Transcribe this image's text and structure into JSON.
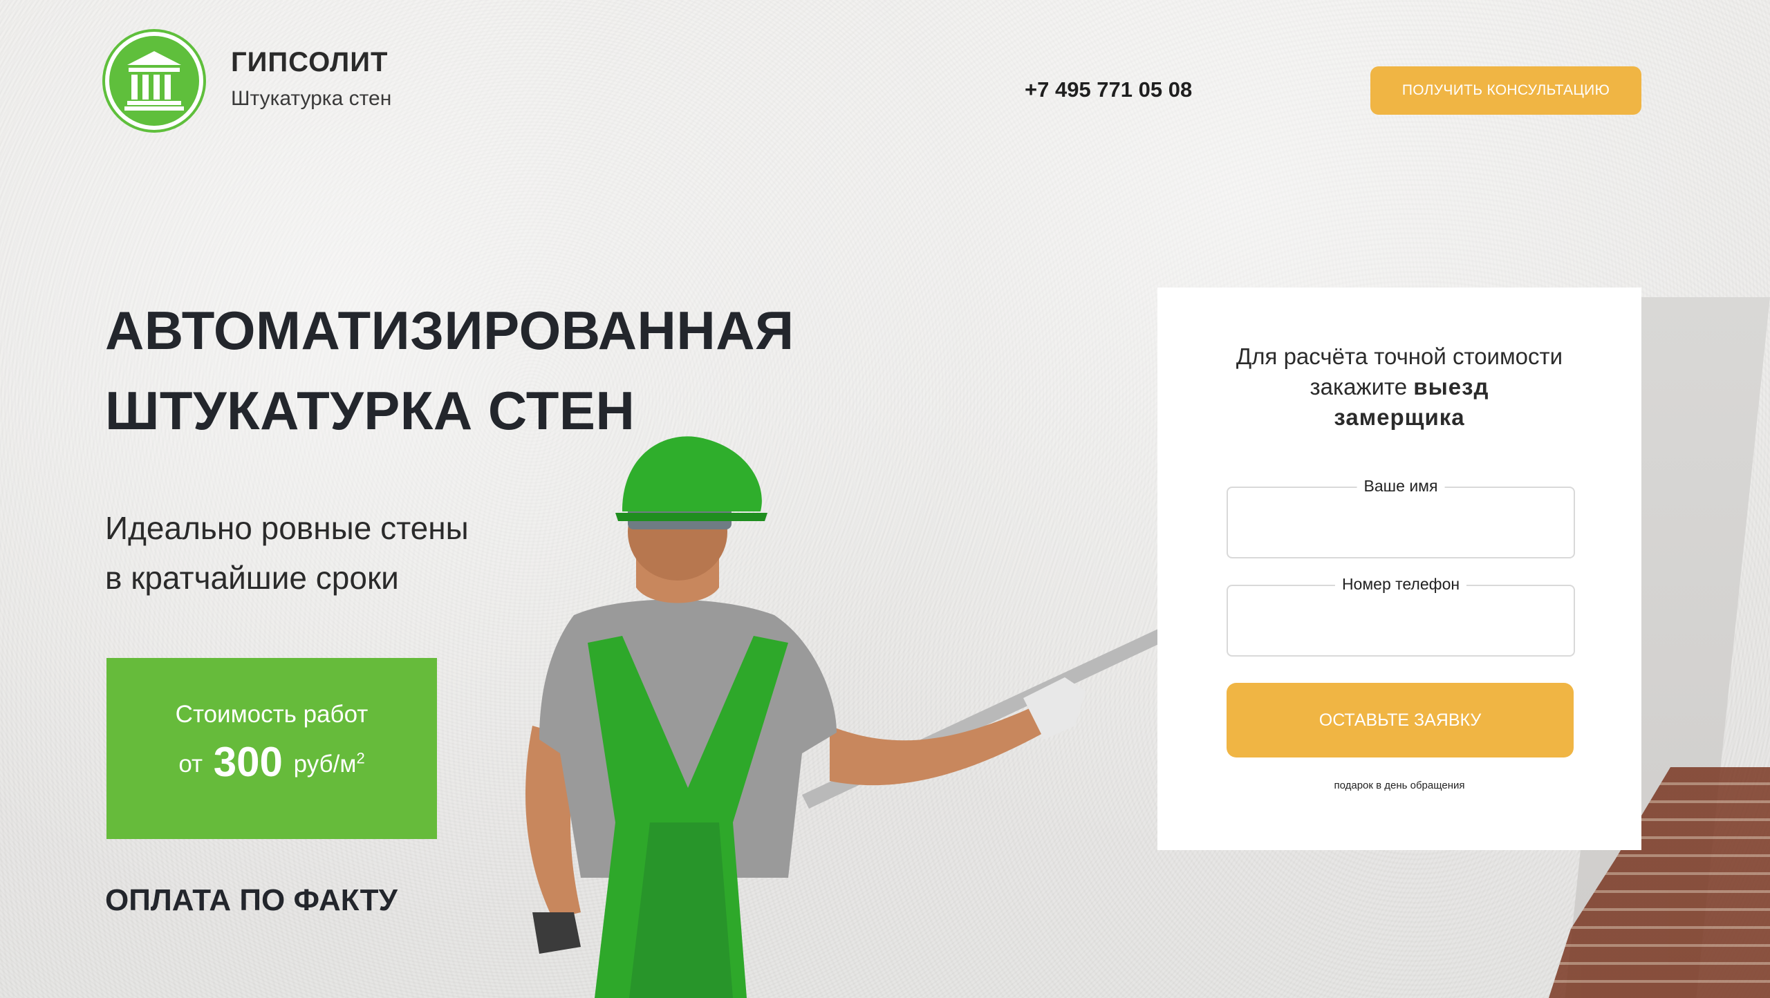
{
  "header": {
    "brand_name": "ГИПСОЛИТ",
    "brand_tagline": "Штукатурка стен",
    "phone": "+7 495 771 05 08",
    "consult_button": "ПОЛУЧИТЬ КОНСУЛЬТАЦИЮ"
  },
  "hero": {
    "title_line1": "АВТОМАТИЗИРОВАННАЯ",
    "title_line2": "ШТУКАТУРКА СТЕН",
    "subtitle_line1": "Идеально ровные стены",
    "subtitle_line2": "в кратчайшие сроки",
    "price": {
      "label": "Стоимость работ",
      "prefix": "от",
      "value": "300",
      "unit": "руб/м",
      "unit_sup": "2"
    },
    "payment_note": "ОПЛАТА ПО ФАКТУ"
  },
  "form": {
    "title_line1": "Для расчёта точной стоимости",
    "title_line2_plain": "закажите",
    "title_line2_bold": "выезд",
    "title_line3_bold": "замерщика",
    "name_label": "Ваше имя",
    "name_value": "",
    "phone_label": "Номер телефон",
    "phone_value": "",
    "submit_button": "ОСТАВЬТЕ ЗАЯВКУ",
    "gift_note": "подарок в день обращения"
  },
  "colors": {
    "green": "#66bb3b",
    "orange": "#f0b544",
    "dark_text": "#23262c"
  },
  "icons": {
    "logo": "classical-building-icon"
  }
}
